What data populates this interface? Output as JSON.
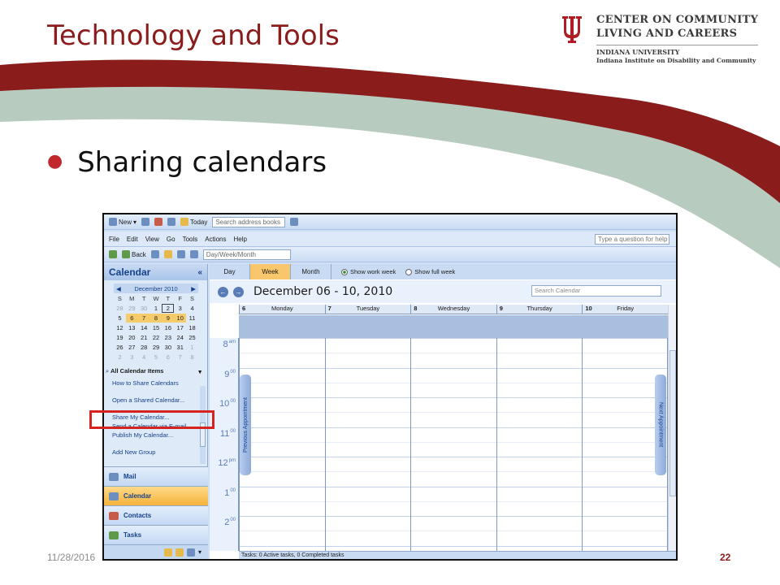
{
  "slide": {
    "title": "Technology and Tools",
    "bullet": "Sharing calendars",
    "footer_date": "11/28/2016",
    "page_number": "22",
    "colors": {
      "crimson": "#8a1c1c",
      "sage": "#b8cbbf",
      "accent_red": "#c0282d"
    }
  },
  "logo": {
    "line1": "CENTER ON COMMUNITY",
    "line2": "LIVING AND CAREERS",
    "line3": "INDIANA UNIVERSITY",
    "line4": "Indiana Institute on Disability and Community",
    "icon": "iu-trident-icon"
  },
  "outlook": {
    "toolbar1": {
      "new_label": "New",
      "today_label": "Today",
      "address_placeholder": "Search address books"
    },
    "menu": [
      "File",
      "Edit",
      "View",
      "Go",
      "Tools",
      "Actions",
      "Help"
    ],
    "help_placeholder": "Type a question for help",
    "toolbar3": {
      "back_label": "Back",
      "view_select": "Day/Week/Month"
    },
    "nav": {
      "title": "Calendar",
      "collapse_glyph": "«",
      "mini_cal": {
        "month": "December 2010",
        "weekdays": [
          "S",
          "M",
          "T",
          "W",
          "T",
          "F",
          "S"
        ],
        "days": [
          "28",
          "29",
          "30",
          "1",
          "2",
          "3",
          "4",
          "5",
          "6",
          "7",
          "8",
          "9",
          "10",
          "11",
          "12",
          "13",
          "14",
          "15",
          "16",
          "17",
          "18",
          "19",
          "20",
          "21",
          "22",
          "23",
          "24",
          "25",
          "26",
          "27",
          "28",
          "29",
          "30",
          "31",
          "1",
          "2",
          "3",
          "4",
          "5",
          "6",
          "7",
          "8"
        ]
      },
      "all_items": "All Calendar Items",
      "links": [
        "How to Share Calendars",
        "Open a Shared Calendar...",
        "Share My Calendar...",
        "Send a Calendar via E-mail...",
        "Publish My Calendar...",
        "Add New Group"
      ],
      "buttons": [
        "Mail",
        "Calendar",
        "Contacts",
        "Tasks"
      ]
    },
    "calendar": {
      "views": [
        "Day",
        "Week",
        "Month"
      ],
      "active_view": "Week",
      "show_work_week": "Show work week",
      "show_full_week": "Show full week",
      "range_title": "December 06 - 10, 2010",
      "search_placeholder": "Search Calendar",
      "days": [
        {
          "num": "6",
          "name": "Monday"
        },
        {
          "num": "7",
          "name": "Tuesday"
        },
        {
          "num": "8",
          "name": "Wednesday"
        },
        {
          "num": "9",
          "name": "Thursday"
        },
        {
          "num": "10",
          "name": "Friday"
        }
      ],
      "times": [
        {
          "h": "8",
          "s": "am"
        },
        {
          "h": "9",
          "s": "00"
        },
        {
          "h": "10",
          "s": "00"
        },
        {
          "h": "11",
          "s": "00"
        },
        {
          "h": "12",
          "s": "pm"
        },
        {
          "h": "1",
          "s": "00"
        },
        {
          "h": "2",
          "s": "00"
        }
      ],
      "prev_appointment": "Previous Appointment",
      "next_appointment": "Next Appointment",
      "tasks_status": "Tasks: 0 Active tasks, 0 Completed tasks"
    }
  }
}
